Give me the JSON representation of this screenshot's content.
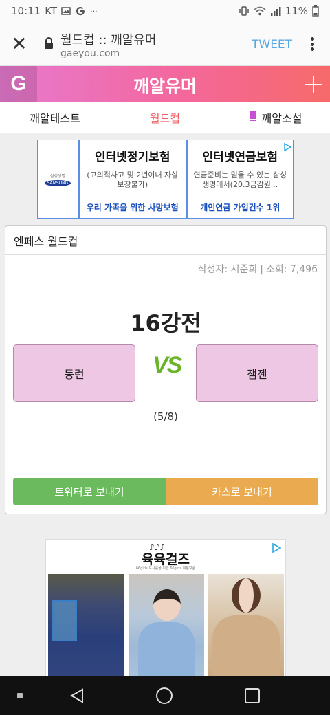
{
  "status_bar": {
    "time": "10:11",
    "carrier": "KT",
    "battery_percent": "11%",
    "icons": [
      "image-icon",
      "google-icon",
      "more-notifications-icon",
      "vibrate-icon",
      "wifi-icon",
      "signal-icon",
      "battery-icon"
    ]
  },
  "browser": {
    "page_title": "월드컵 :: 깨알유머",
    "url": "gaeyou.com",
    "tweet_label": "TWEET",
    "icons": [
      "close-icon",
      "lock-icon",
      "more-vert-icon"
    ]
  },
  "site_header": {
    "logo_letter": "G",
    "title": "깨알유머",
    "plus": "+",
    "gradient": [
      "#e67ad0",
      "#f4679c",
      "#f66a6a"
    ]
  },
  "nav_tabs": [
    {
      "label": "깨알테스트",
      "active": false
    },
    {
      "label": "월드컵",
      "active": true
    },
    {
      "label": "깨알소설",
      "active": false,
      "icon": "book-icon"
    }
  ],
  "ad1": {
    "brand_text": "삼성생명",
    "brand_logo": "SAMSUNG",
    "items": [
      {
        "title": "인터넷정기보험",
        "desc": "(고의적사고 및 2년이내 자살보장불가)",
        "link": "우리 가족을 위한 사망보험"
      },
      {
        "title": "인터넷연금보험",
        "desc": "연금준비는 믿을 수 있는 삼성생명에서(20.3금감원...",
        "link": "개인연금 가입건수 1위"
      }
    ]
  },
  "worldcup": {
    "header": "엔페스 월드컵",
    "author_label": "작성자: 시준희",
    "separator": "|",
    "views_label": "조회: 7,496",
    "round": "16강전",
    "candidate_left": "동런",
    "vs": "VS",
    "candidate_right": "잼젠",
    "progress": "(5/8)",
    "share_twitter": "트위터로 보내기",
    "share_kakao": "카스로 보내기",
    "colors": {
      "candidate_bg": "#edc7e3",
      "vs": "#6ab32b",
      "twitter": "#6cba5e",
      "kakao": "#eaaa4f"
    }
  },
  "ad2": {
    "brand_icon": "♪♪♪",
    "brand": "육육걸즈",
    "tagline": "66girls 도시를을 위한 66girls 여분모품"
  }
}
